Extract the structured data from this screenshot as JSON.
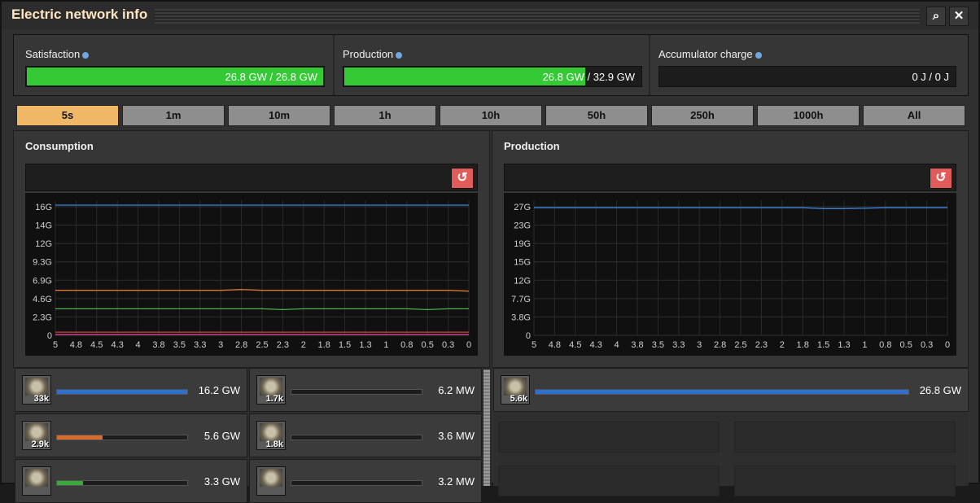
{
  "window": {
    "title": "Electric network info"
  },
  "stats": {
    "satisfaction": {
      "label": "Satisfaction",
      "value": "26.8 GW / 26.8 GW",
      "fill": 1.0
    },
    "production": {
      "label": "Production",
      "value": "26.8 GW / 32.9 GW",
      "fill": 0.815
    },
    "accumulator": {
      "label": "Accumulator charge",
      "value": "0 J / 0 J",
      "fill": 0.0
    }
  },
  "tabs": [
    "5s",
    "1m",
    "10m",
    "1h",
    "10h",
    "50h",
    "250h",
    "1000h",
    "All"
  ],
  "active_tab": "5s",
  "consumption": {
    "title": "Consumption"
  },
  "production_panel": {
    "title": "Production"
  },
  "chart_data": [
    {
      "type": "line",
      "title": "Consumption",
      "x_ticks": [
        "5",
        "4.8",
        "4.5",
        "4.3",
        "4",
        "3.8",
        "3.5",
        "3.3",
        "3",
        "2.8",
        "2.5",
        "2.3",
        "2",
        "1.8",
        "1.5",
        "1.3",
        "1",
        "0.8",
        "0.5",
        "0.3",
        "0"
      ],
      "y_ticks": [
        "0",
        "2.3G",
        "4.6G",
        "6.9G",
        "9.3G",
        "12G",
        "14G",
        "16G"
      ],
      "ylim": [
        0,
        18
      ],
      "grid": true,
      "series": [
        {
          "color": "#3d7fd6",
          "values": [
            16.2,
            16.2,
            16.2,
            16.2,
            16.2,
            16.2,
            16.2,
            16.2,
            16.2,
            16.2,
            16.2,
            16.2,
            16.2,
            16.2,
            16.2,
            16.2,
            16.2,
            16.2,
            16.2,
            16.2,
            16.2
          ]
        },
        {
          "color": "#e0743a",
          "values": [
            5.6,
            5.6,
            5.6,
            5.6,
            5.6,
            5.6,
            5.6,
            5.6,
            5.6,
            5.7,
            5.6,
            5.6,
            5.6,
            5.6,
            5.6,
            5.6,
            5.6,
            5.6,
            5.6,
            5.6,
            5.5
          ]
        },
        {
          "color": "#4fb04f",
          "values": [
            3.3,
            3.3,
            3.3,
            3.3,
            3.3,
            3.3,
            3.3,
            3.3,
            3.3,
            3.3,
            3.3,
            3.2,
            3.3,
            3.3,
            3.3,
            3.3,
            3.3,
            3.3,
            3.2,
            3.3,
            3.3
          ]
        },
        {
          "color": "#e04aa0",
          "values": [
            0.1,
            0.1,
            0.1,
            0.1,
            0.1,
            0.1,
            0.1,
            0.1,
            0.1,
            0.1,
            0.1,
            0.1,
            0.1,
            0.1,
            0.1,
            0.1,
            0.1,
            0.1,
            0.1,
            0.1,
            0.1
          ]
        },
        {
          "color": "#d04040",
          "values": [
            0.4,
            0.4,
            0.4,
            0.4,
            0.4,
            0.4,
            0.4,
            0.4,
            0.4,
            0.4,
            0.4,
            0.4,
            0.4,
            0.4,
            0.4,
            0.4,
            0.4,
            0.4,
            0.4,
            0.4,
            0.4
          ]
        }
      ]
    },
    {
      "type": "line",
      "title": "Production",
      "x_ticks": [
        "5",
        "4.8",
        "4.5",
        "4.3",
        "4",
        "3.8",
        "3.5",
        "3.3",
        "3",
        "2.8",
        "2.5",
        "2.3",
        "2",
        "1.8",
        "1.5",
        "1.3",
        "1",
        "0.8",
        "0.5",
        "0.3",
        "0"
      ],
      "y_ticks": [
        "0",
        "3.8G",
        "7.7G",
        "12G",
        "15G",
        "19G",
        "23G",
        "27G"
      ],
      "ylim": [
        0,
        30
      ],
      "grid": true,
      "series": [
        {
          "color": "#3d7fd6",
          "values": [
            26.8,
            26.8,
            26.8,
            26.8,
            26.8,
            26.8,
            26.8,
            26.8,
            26.8,
            26.8,
            26.8,
            26.8,
            26.8,
            26.8,
            26.6,
            26.6,
            26.7,
            26.8,
            26.8,
            26.8,
            26.8
          ]
        }
      ]
    }
  ],
  "consumers": [
    {
      "count": "33k",
      "value": "16.2 GW",
      "fill": 1.0,
      "color": "#2f6fd0"
    },
    {
      "count": "1.7k",
      "value": "6.2 MW",
      "fill": 0.0,
      "color": "#2f6fd0"
    },
    {
      "count": "2.9k",
      "value": "5.6 GW",
      "fill": 0.35,
      "color": "#d86a2a"
    },
    {
      "count": "1.8k",
      "value": "3.6 MW",
      "fill": 0.0,
      "color": "#2f6fd0"
    },
    {
      "count": "",
      "value": "3.3 GW",
      "fill": 0.2,
      "color": "#3aa83a"
    },
    {
      "count": "",
      "value": "3.2 MW",
      "fill": 0.0,
      "color": "#3aa83a"
    }
  ],
  "producers": [
    {
      "count": "5.6k",
      "value": "26.8 GW",
      "fill": 1.0,
      "color": "#2f6fd0"
    }
  ]
}
